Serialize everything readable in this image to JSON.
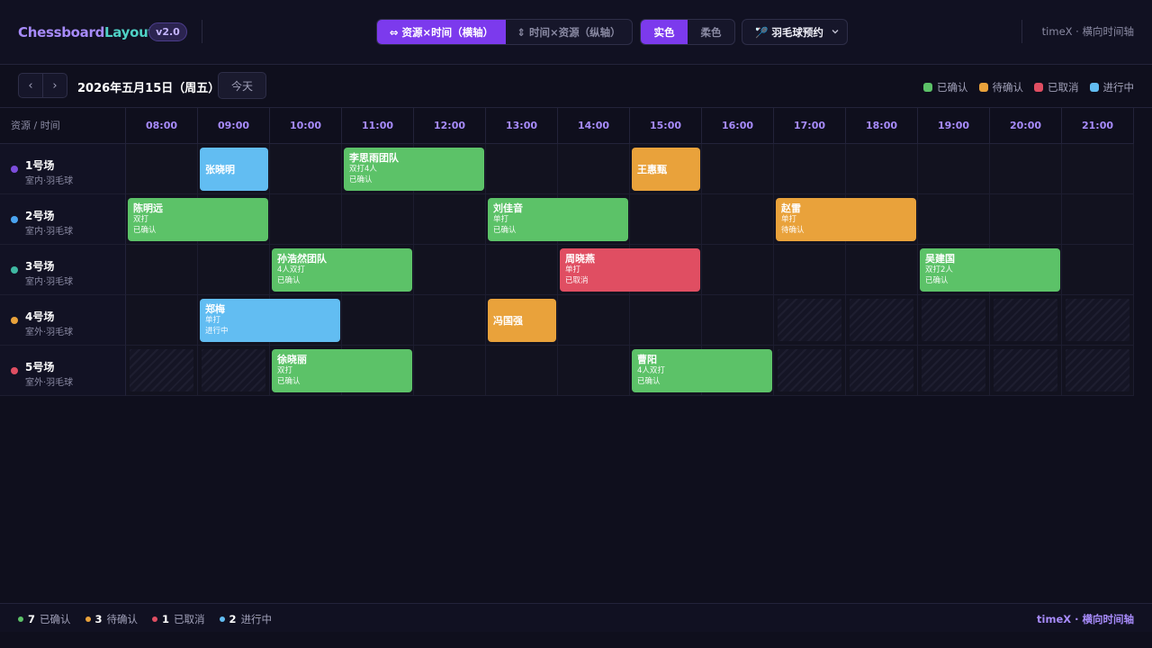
{
  "app": {
    "brand_part1": "Chessboard",
    "brand_part2": "Layout",
    "version": "v2.0"
  },
  "header": {
    "orientation_options": [
      {
        "label": "⇔ 资源×时间（横轴）",
        "active": true
      },
      {
        "label": "⇕ 时间×资源（纵轴）",
        "active": false
      }
    ],
    "style_options": [
      {
        "label": "实色",
        "active": true
      },
      {
        "label": "柔色",
        "active": false
      }
    ],
    "scenario_select": "🏸 羽毛球预约",
    "right_text": "timeX · 横向时间轴"
  },
  "toolbar": {
    "prev": "‹",
    "next": "›",
    "date": "2026年五月15日（周五）",
    "today": "今天"
  },
  "status_colors": {
    "confirmed": "#5cc268",
    "pending": "#e9a23b",
    "cancelled": "#e04e62",
    "active": "#62bdf2"
  },
  "legend": [
    {
      "key": "confirmed",
      "label": "已确认"
    },
    {
      "key": "pending",
      "label": "待确认"
    },
    {
      "key": "cancelled",
      "label": "已取消"
    },
    {
      "key": "active",
      "label": "进行中"
    }
  ],
  "grid": {
    "corner_label": "资源 / 时间",
    "times": [
      "08:00",
      "09:00",
      "10:00",
      "11:00",
      "12:00",
      "13:00",
      "14:00",
      "15:00",
      "16:00",
      "17:00",
      "18:00",
      "19:00",
      "20:00",
      "21:00"
    ]
  },
  "resources": [
    {
      "name": "1号场",
      "sub": "室内·羽毛球",
      "color": "#7c4ddb",
      "blocked": []
    },
    {
      "name": "2号场",
      "sub": "室内·羽毛球",
      "color": "#4aa3f0",
      "blocked": []
    },
    {
      "name": "3号场",
      "sub": "室内·羽毛球",
      "color": "#3fb8a2",
      "blocked": []
    },
    {
      "name": "4号场",
      "sub": "室外·羽毛球",
      "color": "#e9a23b",
      "blocked": [
        9,
        10,
        11,
        12,
        13
      ]
    },
    {
      "name": "5号场",
      "sub": "室外·羽毛球",
      "color": "#e04e62",
      "blocked": [
        0,
        1,
        9,
        10,
        11,
        12,
        13
      ]
    }
  ],
  "bookings": [
    {
      "row": 0,
      "start": 1,
      "span": 1,
      "name": "张晓明",
      "detail": "",
      "status": "active",
      "status_label": ""
    },
    {
      "row": 0,
      "start": 3,
      "span": 2,
      "name": "李思雨团队",
      "detail": "双打4人",
      "status": "confirmed",
      "status_label": "已确认"
    },
    {
      "row": 0,
      "start": 7,
      "span": 1,
      "name": "王惠甄",
      "detail": "",
      "status": "pending",
      "status_label": ""
    },
    {
      "row": 1,
      "start": 0,
      "span": 2,
      "name": "陈明远",
      "detail": "双打",
      "status": "confirmed",
      "status_label": "已确认"
    },
    {
      "row": 1,
      "start": 5,
      "span": 2,
      "name": "刘佳音",
      "detail": "单打",
      "status": "confirmed",
      "status_label": "已确认"
    },
    {
      "row": 1,
      "start": 9,
      "span": 2,
      "name": "赵雷",
      "detail": "单打",
      "status": "pending",
      "status_label": "待确认"
    },
    {
      "row": 2,
      "start": 2,
      "span": 2,
      "name": "孙浩然团队",
      "detail": "4人双打",
      "status": "confirmed",
      "status_label": "已确认"
    },
    {
      "row": 2,
      "start": 6,
      "span": 2,
      "name": "周晓燕",
      "detail": "单打",
      "status": "cancelled",
      "status_label": "已取消"
    },
    {
      "row": 2,
      "start": 11,
      "span": 2,
      "name": "吴建国",
      "detail": "双打2人",
      "status": "confirmed",
      "status_label": "已确认"
    },
    {
      "row": 3,
      "start": 1,
      "span": 2,
      "name": "郑梅",
      "detail": "单打",
      "status": "active",
      "status_label": "进行中"
    },
    {
      "row": 3,
      "start": 5,
      "span": 1,
      "name": "冯国强",
      "detail": "",
      "status": "pending",
      "status_label": ""
    },
    {
      "row": 4,
      "start": 2,
      "span": 2,
      "name": "徐晓丽",
      "detail": "双打",
      "status": "confirmed",
      "status_label": "已确认"
    },
    {
      "row": 4,
      "start": 7,
      "span": 2,
      "name": "曹阳",
      "detail": "4人双打",
      "status": "confirmed",
      "status_label": "已确认"
    }
  ],
  "footer": {
    "stats": [
      {
        "key": "confirmed",
        "count": "7",
        "label": "已确认"
      },
      {
        "key": "pending",
        "count": "3",
        "label": "待确认"
      },
      {
        "key": "cancelled",
        "count": "1",
        "label": "已取消"
      },
      {
        "key": "active",
        "count": "2",
        "label": "进行中"
      }
    ],
    "right_text": "timeX · 横向时间轴"
  }
}
